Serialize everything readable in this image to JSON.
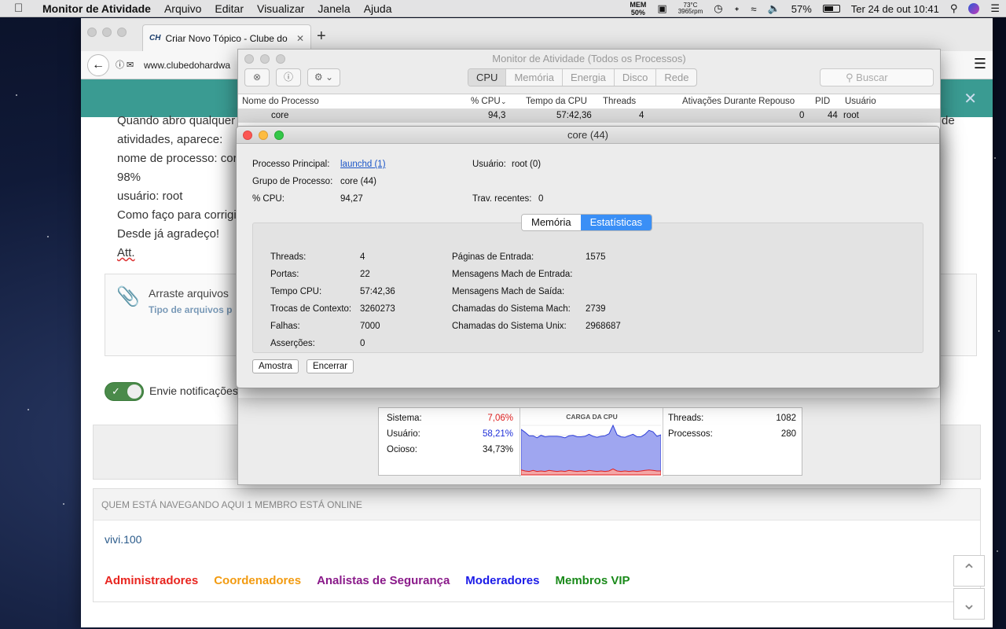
{
  "menubar": {
    "app": "Monitor de Atividade",
    "items": [
      "Arquivo",
      "Editar",
      "Visualizar",
      "Janela",
      "Ajuda"
    ],
    "mem_label": "MEM",
    "mem_value": "50%",
    "temp": "73°C",
    "rpm": "3965rpm",
    "battery": "57%",
    "datetime": "Ter 24 de out  10:41"
  },
  "browser": {
    "tab_title": "Criar Novo Tópico - Clube do",
    "tab_favicon": "CH",
    "url": "www.clubedohardwa",
    "page_lines": [
      "Quando abro qualquer",
      "atividades, aparece:",
      "nome de processo: cor",
      "98%",
      "usuário: root",
      "Como faço para corrigi",
      "Desde já agradeço!",
      "Att."
    ],
    "right_fragment": "de",
    "attach_title": "Arraste arquivos",
    "attach_sub": "Tipo de arquivos p",
    "toggle_label": "Envie notificações",
    "online_header": "QUEM ESTÁ NAVEGANDO AQUI   1 MEMBRO ESTÁ ONLINE",
    "online_user": "vivi.100",
    "roles": [
      {
        "label": "Administradores",
        "color": "#e8251f"
      },
      {
        "label": "Coordenadores",
        "color": "#f29b11"
      },
      {
        "label": "Analistas de Segurança",
        "color": "#8a1a8a"
      },
      {
        "label": "Moderadores",
        "color": "#1a1ae8"
      },
      {
        "label": "Membros VIP",
        "color": "#1a8a1a"
      }
    ]
  },
  "activity_monitor": {
    "title": "Monitor de Atividade (Todos os Processos)",
    "tabs": [
      "CPU",
      "Memória",
      "Energia",
      "Disco",
      "Rede"
    ],
    "active_tab": "CPU",
    "search_placeholder": "Buscar",
    "columns": [
      "Nome do Processo",
      "% CPU",
      "Tempo da CPU",
      "Threads",
      "Ativações Durante Repouso",
      "PID",
      "Usuário"
    ],
    "row": {
      "name": "core",
      "cpu": "94,3",
      "time": "57:42,36",
      "threads": "4",
      "wakeups": "0",
      "pid": "44",
      "user": "root"
    },
    "summary": {
      "sistema_label": "Sistema:",
      "sistema": "7,06%",
      "usuario_label": "Usuário:",
      "usuario": "58,21%",
      "ocioso_label": "Ocioso:",
      "ocioso": "34,73%",
      "graph_title": "CARGA DA CPU",
      "threads_label": "Threads:",
      "threads": "1082",
      "processos_label": "Processos:",
      "processos": "280"
    },
    "cpu_load_user": [
      0.82,
      0.78,
      0.72,
      0.7,
      0.68,
      0.72,
      0.7,
      0.69,
      0.7,
      0.71,
      0.69,
      0.68,
      0.7,
      0.72,
      0.7,
      0.69,
      0.71,
      0.73,
      0.7,
      0.69,
      0.7,
      0.72,
      0.75,
      0.92,
      0.73,
      0.7,
      0.68,
      0.72,
      0.74,
      0.7,
      0.69,
      0.73,
      0.8,
      0.78,
      0.7,
      0.73
    ],
    "cpu_load_system": [
      0.1,
      0.08,
      0.07,
      0.09,
      0.07,
      0.08,
      0.07,
      0.09,
      0.08,
      0.07,
      0.08,
      0.07,
      0.09,
      0.08,
      0.07,
      0.08,
      0.07,
      0.09,
      0.08,
      0.07,
      0.08,
      0.07,
      0.08,
      0.12,
      0.08,
      0.07,
      0.08,
      0.07,
      0.08,
      0.07,
      0.08,
      0.09,
      0.1,
      0.09,
      0.08,
      0.08
    ]
  },
  "core_window": {
    "title": "core (44)",
    "processo_principal_label": "Processo Principal:",
    "processo_principal": "launchd (1)",
    "usuario_label": "Usuário:",
    "usuario": "root (0)",
    "grupo_label": "Grupo de Processo:",
    "grupo": "core (44)",
    "cpu_label": "% CPU:",
    "cpu": "94,27",
    "trav_label": "Trav. recentes:",
    "trav": "0",
    "tab_memoria": "Memória",
    "tab_estatisticas": "Estatísticas",
    "left_stats": [
      {
        "label": "Threads:",
        "value": "4"
      },
      {
        "label": "Portas:",
        "value": "22"
      },
      {
        "label": "Tempo CPU:",
        "value": "57:42,36"
      },
      {
        "label": "Trocas de Contexto:",
        "value": "3260273"
      },
      {
        "label": "Falhas:",
        "value": "7000"
      },
      {
        "label": "Asserções:",
        "value": "0"
      }
    ],
    "right_stats": [
      {
        "label": "Páginas de Entrada:",
        "value": "1575"
      },
      {
        "label": "Mensagens Mach de Entrada:",
        "value": ""
      },
      {
        "label": "Mensagens Mach de Saída:",
        "value": ""
      },
      {
        "label": "Chamadas do Sistema Mach:",
        "value": "2739"
      },
      {
        "label": "Chamadas do Sistema Unix:",
        "value": "2968687"
      }
    ],
    "btn_amostra": "Amostra",
    "btn_encerrar": "Encerrar"
  }
}
